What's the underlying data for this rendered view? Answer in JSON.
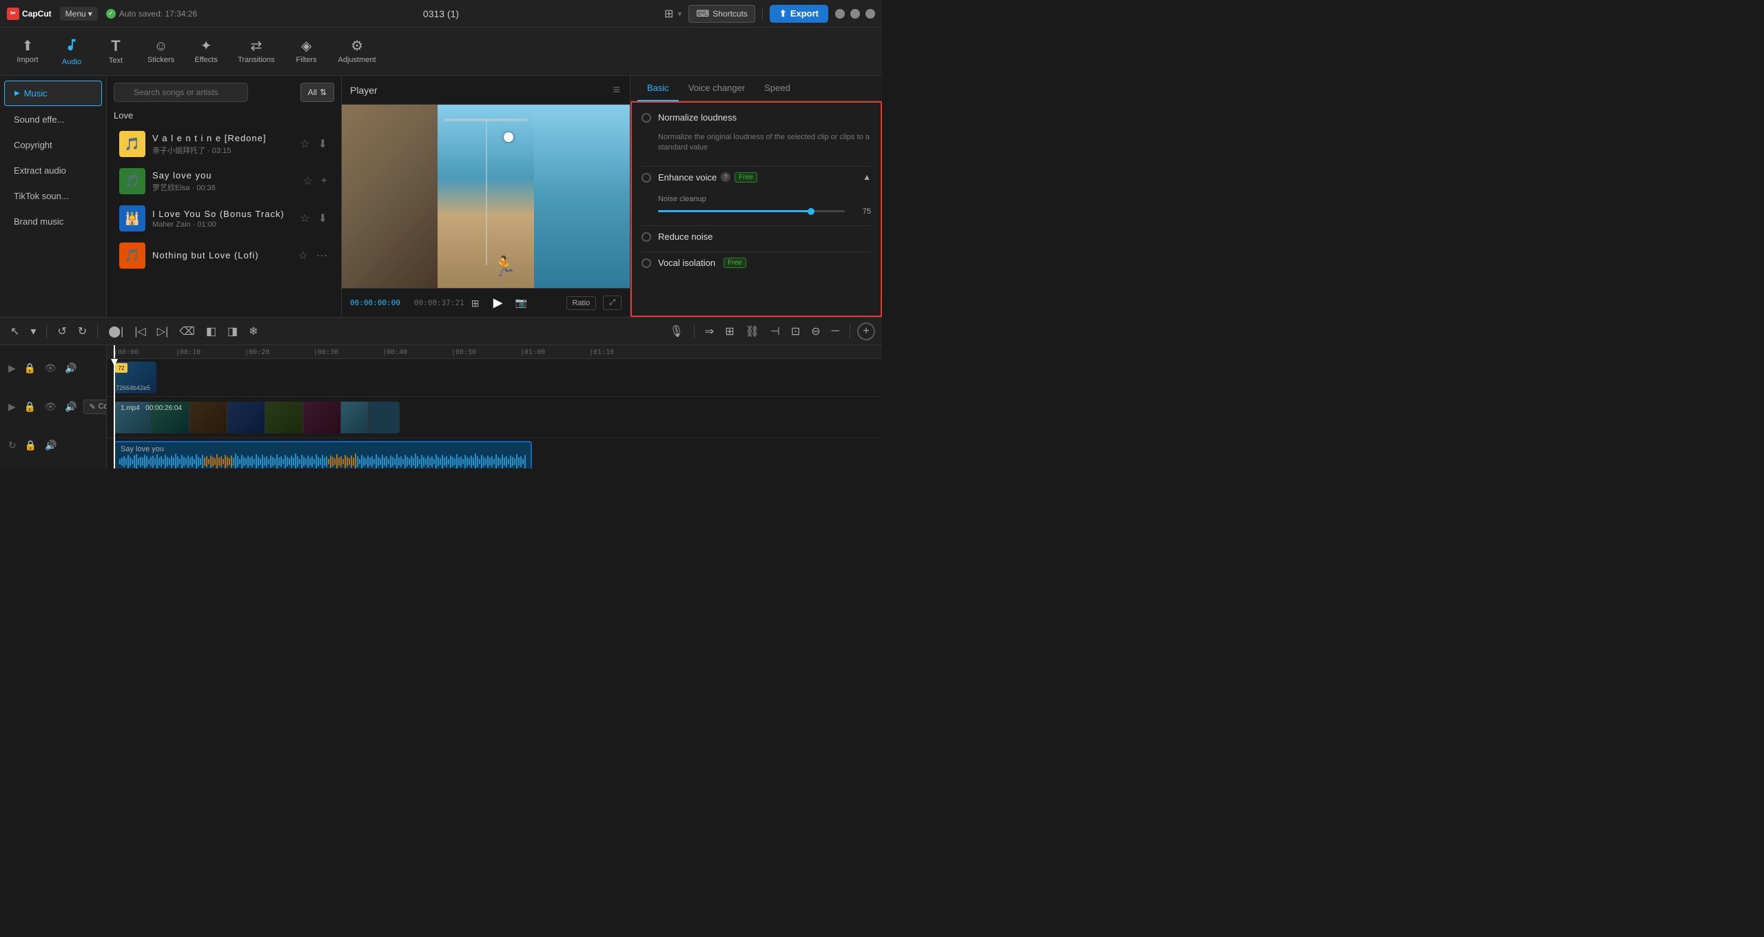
{
  "app": {
    "logo": "CapCut",
    "menu_label": "Menu",
    "auto_saved": "Auto saved: 17:34:26",
    "title": "0313 (1)",
    "shortcuts_label": "Shortcuts",
    "export_label": "Export"
  },
  "toolbar": {
    "items": [
      {
        "id": "import",
        "label": "Import",
        "icon": "⬆"
      },
      {
        "id": "audio",
        "label": "Audio",
        "icon": "♪",
        "active": true
      },
      {
        "id": "text",
        "label": "Text",
        "icon": "T"
      },
      {
        "id": "stickers",
        "label": "Stickers",
        "icon": "☺"
      },
      {
        "id": "effects",
        "label": "Effects",
        "icon": "✦"
      },
      {
        "id": "transitions",
        "label": "Transitions",
        "icon": "⇄"
      },
      {
        "id": "filters",
        "label": "Filters",
        "icon": "◈"
      },
      {
        "id": "adjustment",
        "label": "Adjustment",
        "icon": "⚙"
      }
    ]
  },
  "left_panel": {
    "items": [
      {
        "id": "music",
        "label": "Music",
        "active": true
      },
      {
        "id": "sound_effects",
        "label": "Sound effe..."
      },
      {
        "id": "copyright",
        "label": "Copyright"
      },
      {
        "id": "extract_audio",
        "label": "Extract audio"
      },
      {
        "id": "tiktok_sounds",
        "label": "TikTok soun..."
      },
      {
        "id": "brand_music",
        "label": "Brand music"
      }
    ]
  },
  "music_panel": {
    "search_placeholder": "Search songs or artists",
    "all_label": "All",
    "section_label": "Love",
    "songs": [
      {
        "id": 1,
        "title": "V a l e n t i n e  [Redone]",
        "artist": "亲子小姐拜托了",
        "duration": "03:15",
        "thumb_color": "yellow",
        "thumb_icon": "🎵"
      },
      {
        "id": 2,
        "title": "Say love you",
        "artist": "罗艺欣Elsa",
        "duration": "00:38",
        "thumb_color": "green",
        "thumb_icon": "🎵"
      },
      {
        "id": 3,
        "title": "I Love You So (Bonus Track)",
        "artist": "Maher Zain",
        "duration": "01:00",
        "thumb_color": "blue",
        "thumb_icon": "🕌"
      },
      {
        "id": 4,
        "title": "Nothing but Love (Lofi)",
        "artist": "",
        "duration": "",
        "thumb_color": "orange",
        "thumb_icon": "🎵"
      }
    ]
  },
  "player": {
    "title": "Player",
    "time_current": "00:00:00:00",
    "time_total": "00:00:37:21",
    "ratio_label": "Ratio"
  },
  "right_panel": {
    "tabs": [
      {
        "id": "basic",
        "label": "Basic",
        "active": true
      },
      {
        "id": "voice_changer",
        "label": "Voice changer"
      },
      {
        "id": "speed",
        "label": "Speed"
      }
    ],
    "normalize_loudness": {
      "label": "Normalize loudness",
      "description": "Normalize the original loudness of the selected clip or clips to a standard value"
    },
    "enhance_voice": {
      "label": "Enhance voice",
      "badge": "Free"
    },
    "noise_cleanup": {
      "label": "Noise cleanup",
      "value": 75,
      "fill_pct": 82
    },
    "reduce_noise": {
      "label": "Reduce noise"
    },
    "vocal_isolation": {
      "label": "Vocal isolation",
      "badge": "Free"
    }
  },
  "timeline": {
    "cursor_position": "00:00",
    "ruler_marks": [
      "00:00",
      "00:10",
      "00:20",
      "00:30",
      "00:40",
      "00:50",
      "01:00",
      "01:10"
    ],
    "clips": [
      {
        "id": "video_thumb",
        "label": "72664b42e5",
        "type": "thumbnail"
      },
      {
        "id": "video_main",
        "label": "1.mp4",
        "duration": "00:00:26:04",
        "type": "videostrip"
      },
      {
        "id": "audio_main",
        "label": "Say love you",
        "type": "audio"
      }
    ],
    "cover_label": "Cover"
  },
  "icons": {
    "search": "🔍",
    "star": "☆",
    "download": "⬇",
    "plus": "+",
    "menu": "≡",
    "play": "▶",
    "undo": "↺",
    "redo": "↻",
    "cut": "✂",
    "delete": "⌫",
    "zoom_in": "⊕",
    "zoom_out": "⊖",
    "mic": "🎙",
    "lock": "🔒",
    "eye": "👁",
    "speaker": "🔊",
    "loop": "↻",
    "scissors": "✂",
    "edit": "✎"
  }
}
